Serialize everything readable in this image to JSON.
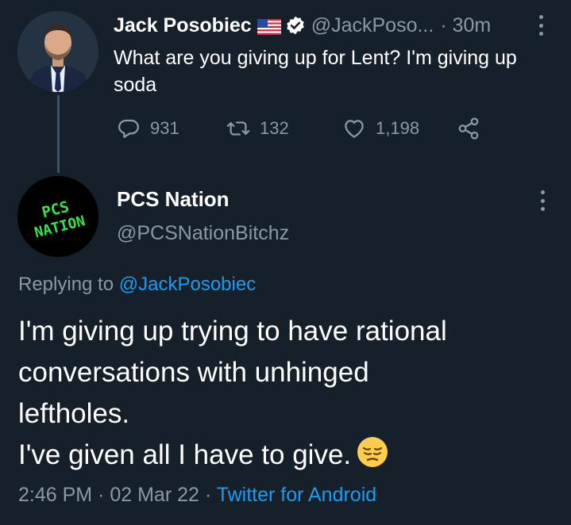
{
  "parent_tweet": {
    "display_name": "Jack Posobiec",
    "flag_icon": "us-flag-emoji",
    "verified_icon": "verified-badge-icon",
    "handle": "@JackPoso...",
    "separator": "·",
    "time": "30m",
    "text": "What are you giving up for Lent? I'm giving up soda",
    "actions": {
      "replies": "931",
      "retweets": "132",
      "likes": "1,198"
    }
  },
  "reply_tweet": {
    "display_name": "PCS Nation",
    "handle": "@PCSNationBitchz",
    "avatar_text": {
      "line1": "PCS",
      "line2": "NATION"
    },
    "replying_prefix": "Replying to",
    "replying_handle": "@JackPosobiec",
    "text_lines": [
      "I'm giving up trying to have rational",
      "conversations with unhinged",
      "leftholes.",
      "I've given all I have to give."
    ],
    "emoji": "pensive-face-emoji",
    "time": "2:46 PM",
    "sep1": "·",
    "date": "02 Mar 22",
    "sep2": "·",
    "source": "Twitter for Android"
  },
  "colors": {
    "background": "#15202b",
    "secondary_text": "#8b98a5",
    "link": "#1d9bf0",
    "avatar_logo_green": "#39e34a"
  }
}
